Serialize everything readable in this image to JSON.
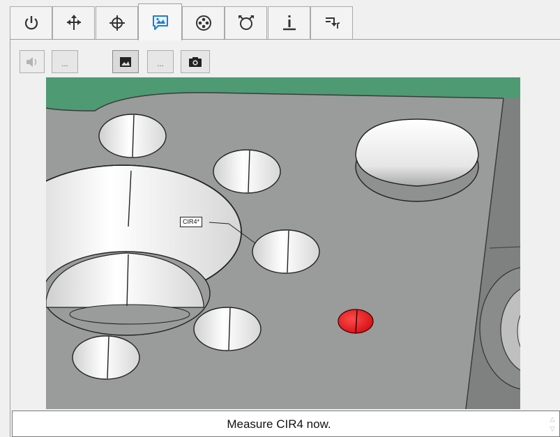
{
  "tabs": [
    {
      "icon": "power-icon"
    },
    {
      "icon": "move-arrows-icon"
    },
    {
      "icon": "crosshair-icon"
    },
    {
      "icon": "image-message-icon",
      "active": true
    },
    {
      "icon": "probe-target-icon"
    },
    {
      "icon": "loop-icon"
    },
    {
      "icon": "info-icon"
    },
    {
      "icon": "step-arrow-icon"
    }
  ],
  "toolbar": {
    "sound_more_label": "...",
    "image_more_label": "..."
  },
  "viewport": {
    "feature_tag": "CIR4*"
  },
  "colors": {
    "part_surface": "#9a9b9b",
    "fixture_green": "#4e9a73",
    "hole_wall": "#f1f1f1",
    "target_highlight": "#e8131a"
  },
  "status": {
    "message": "Measure CIR4 now."
  }
}
